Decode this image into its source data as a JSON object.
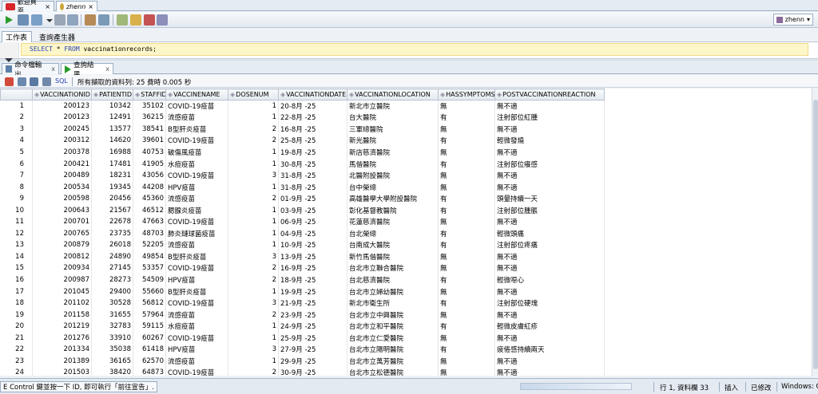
{
  "doc_tabs": [
    {
      "label": "歡迎頁面",
      "close": "×"
    },
    {
      "label": "zhenn",
      "close": "×"
    }
  ],
  "toolbar": {
    "connection": "zhenn"
  },
  "subtabs": [
    "工作表",
    "查詢產生器"
  ],
  "editor": {
    "kw_select": "SELECT",
    "star": "*",
    "kw_from": "FROM",
    "table": "vaccinationrecords;"
  },
  "result_tabs": [
    {
      "label": "命令檔輸出",
      "close": "x"
    },
    {
      "label": "查詢結果",
      "close": "x"
    }
  ],
  "result_toolbar": {
    "sql_label": "SQL",
    "status": "所有擷取的資料列: 25 費時 0.005 秒"
  },
  "colors": {
    "accent_blue": "#1f3fb8",
    "run_green": "#2b9a2b",
    "oracle_red": "#d8262b",
    "editor_highlight": "#fdf6c8"
  },
  "grid": {
    "columns": [
      "VACCINATIONID",
      "PATIENTID",
      "STAFFID",
      "VACCINENAME",
      "DOSENUM",
      "VACCINATIONDATE",
      "VACCINATIONLOCATION",
      "HASSYMPTOMS",
      "POSTVACCINATIONREACTION"
    ],
    "rows": [
      [
        "1",
        "200123",
        "10342",
        "35102",
        "COVID-19疫苗",
        "1",
        "20-8月 -25",
        "新北市立醫院",
        "無",
        "無不適"
      ],
      [
        "2",
        "200123",
        "12491",
        "36215",
        "流感疫苗",
        "1",
        "22-8月 -25",
        "台大醫院",
        "有",
        "注射部位紅腫"
      ],
      [
        "3",
        "200245",
        "13577",
        "38541",
        "B型肝炎疫苗",
        "2",
        "16-8月 -25",
        "三軍總醫院",
        "無",
        "無不適"
      ],
      [
        "4",
        "200312",
        "14620",
        "39601",
        "COVID-19疫苗",
        "2",
        "25-8月 -25",
        "新光醫院",
        "有",
        "輕微發燒"
      ],
      [
        "5",
        "200378",
        "16988",
        "40753",
        "破傷風疫苗",
        "1",
        "19-8月 -25",
        "新店慈濟醫院",
        "無",
        "無不適"
      ],
      [
        "6",
        "200421",
        "17481",
        "41905",
        "水痘疫苗",
        "1",
        "30-8月 -25",
        "馬偕醫院",
        "有",
        "注射部位癢感"
      ],
      [
        "7",
        "200489",
        "18231",
        "43056",
        "COVID-19疫苗",
        "3",
        "31-8月 -25",
        "北醫附設醫院",
        "無",
        "無不適"
      ],
      [
        "8",
        "200534",
        "19345",
        "44208",
        "HPV疫苗",
        "1",
        "31-8月 -25",
        "台中榮總",
        "無",
        "無不適"
      ],
      [
        "9",
        "200598",
        "20456",
        "45360",
        "流感疫苗",
        "2",
        "01-9月 -25",
        "高雄醫學大學附設醫院",
        "有",
        "頭暈持續一天"
      ],
      [
        "10",
        "200643",
        "21567",
        "46512",
        "腮腺炎疫苗",
        "1",
        "03-9月 -25",
        "彰化基督教醫院",
        "有",
        "注射部位腫脹"
      ],
      [
        "11",
        "200701",
        "22678",
        "47663",
        "COVID-19疫苗",
        "1",
        "06-9月 -25",
        "花蓮慈濟醫院",
        "無",
        "無不適"
      ],
      [
        "12",
        "200765",
        "23735",
        "48703",
        "肺炎鏈球菌疫苗",
        "1",
        "04-9月 -25",
        "台北榮總",
        "有",
        "輕微頭痛"
      ],
      [
        "13",
        "200879",
        "26018",
        "52205",
        "流感疫苗",
        "1",
        "10-9月 -25",
        "台南成大醫院",
        "有",
        "注射部位疼痛"
      ],
      [
        "14",
        "200812",
        "24890",
        "49854",
        "B型肝炎疫苗",
        "3",
        "13-9月 -25",
        "新竹馬偕醫院",
        "無",
        "無不適"
      ],
      [
        "15",
        "200934",
        "27145",
        "53357",
        "COVID-19疫苗",
        "2",
        "16-9月 -25",
        "台北市立聯合醫院",
        "無",
        "無不適"
      ],
      [
        "16",
        "200987",
        "28273",
        "54509",
        "HPV疫苗",
        "2",
        "18-9月 -25",
        "台北慈濟醫院",
        "有",
        "輕微噁心"
      ],
      [
        "17",
        "201045",
        "29400",
        "55660",
        "B型肝炎疫苗",
        "1",
        "19-9月 -25",
        "台北市立婦幼醫院",
        "無",
        "無不適"
      ],
      [
        "18",
        "201102",
        "30528",
        "56812",
        "COVID-19疫苗",
        "3",
        "21-9月 -25",
        "新北市衛生所",
        "有",
        "注射部位硬塊"
      ],
      [
        "19",
        "201158",
        "31655",
        "57964",
        "流感疫苗",
        "2",
        "23-9月 -25",
        "台北市立中興醫院",
        "無",
        "無不適"
      ],
      [
        "20",
        "201219",
        "32783",
        "59115",
        "水痘疫苗",
        "1",
        "24-9月 -25",
        "台北市立和平醫院",
        "有",
        "輕微皮膚紅疹"
      ],
      [
        "21",
        "201276",
        "33910",
        "60267",
        "COVID-19疫苗",
        "1",
        "25-9月 -25",
        "台北市立仁愛醫院",
        "無",
        "無不適"
      ],
      [
        "22",
        "201334",
        "35038",
        "61418",
        "HPV疫苗",
        "3",
        "27-9月 -25",
        "台北市立陽明醫院",
        "有",
        "疲倦感持續兩天"
      ],
      [
        "23",
        "201389",
        "36165",
        "62570",
        "流感疫苗",
        "1",
        "29-9月 -25",
        "台北市立萬芳醫院",
        "無",
        "無不適"
      ],
      [
        "24",
        "201503",
        "38420",
        "64873",
        "COVID-19疫苗",
        "2",
        "30-9月 -25",
        "台北市立松德醫院",
        "無",
        "無不適"
      ]
    ]
  },
  "statusbar": {
    "message": "E Control 鍵並按一下 ID, 即可執行「前往宣告」.",
    "position": "行 1, 資料欄 33",
    "insert_mode": "插入",
    "modified": "已修改",
    "line_ending": "Windows: CF"
  }
}
